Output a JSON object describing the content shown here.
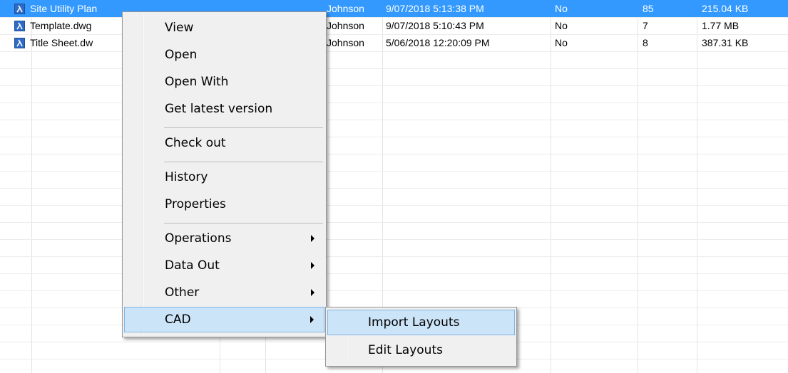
{
  "files": [
    {
      "name": "Site Utility Plan",
      "author": "Johnson",
      "modified": "9/07/2018 5:13:38 PM",
      "checked_out": "No",
      "version": "85",
      "size": "215.04 KB",
      "selected": true
    },
    {
      "name": "Template.dwg",
      "author": "Johnson",
      "modified": "9/07/2018 5:10:43 PM",
      "checked_out": "No",
      "version": "7",
      "size": "1.77 MB",
      "selected": false
    },
    {
      "name": "Title Sheet.dw",
      "author": "Johnson",
      "modified": "5/06/2018 12:20:09 PM",
      "checked_out": "No",
      "version": "8",
      "size": "387.31 KB",
      "selected": false
    }
  ],
  "context_menu": {
    "items": {
      "view": "View",
      "open": "Open",
      "open_with": "Open With",
      "get_latest": "Get latest version",
      "check_out": "Check out",
      "history": "History",
      "properties": "Properties",
      "operations": "Operations",
      "data_out": "Data Out",
      "other": "Other",
      "cad": "CAD"
    },
    "highlighted": "CAD"
  },
  "cad_submenu": {
    "import_layouts": "Import Layouts",
    "edit_layouts": "Edit Layouts",
    "highlighted": "Import Layouts"
  },
  "colors": {
    "selection": "#3399ff",
    "menu_bg": "#f0f0f0",
    "menu_highlight": "#cce4f7"
  }
}
